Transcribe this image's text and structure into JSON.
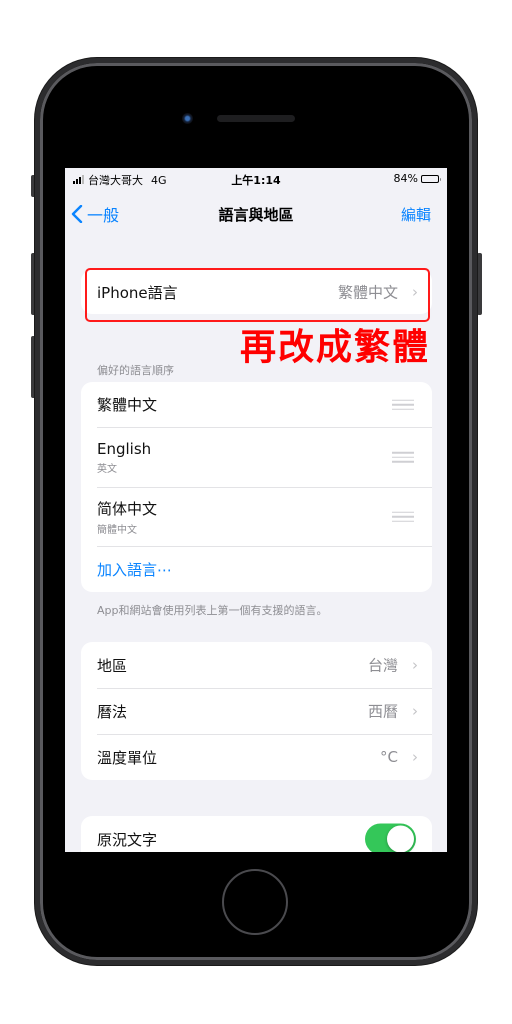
{
  "status_bar": {
    "carrier": "台灣大哥大",
    "network": "4G",
    "time": "上午1:14",
    "battery_percent_label": "84%",
    "battery_level": 0.84
  },
  "nav": {
    "back_label": "一般",
    "title": "語言與地區",
    "edit_label": "編輯"
  },
  "iphone_language": {
    "label": "iPhone語言",
    "value": "繁體中文"
  },
  "annotation": {
    "text": "再改成繁體",
    "color": "#ff0000"
  },
  "preferred_languages": {
    "header": "偏好的語言順序",
    "items": [
      {
        "label": "繁體中文",
        "sub": ""
      },
      {
        "label": "English",
        "sub": "英文"
      },
      {
        "label": "简体中文",
        "sub": "簡體中文"
      }
    ],
    "add_label": "加入語言⋯",
    "footer": "App和網站會使用列表上第一個有支援的語言。"
  },
  "region_settings": [
    {
      "label": "地區",
      "value": "台灣"
    },
    {
      "label": "曆法",
      "value": "西曆"
    },
    {
      "label": "溫度單位",
      "value": "°C"
    }
  ],
  "live_text": {
    "label": "原況文字",
    "enabled": true
  },
  "colors": {
    "accent": "#0a84ff",
    "toggle_on": "#34c759",
    "highlight": "#ff1a1a"
  }
}
